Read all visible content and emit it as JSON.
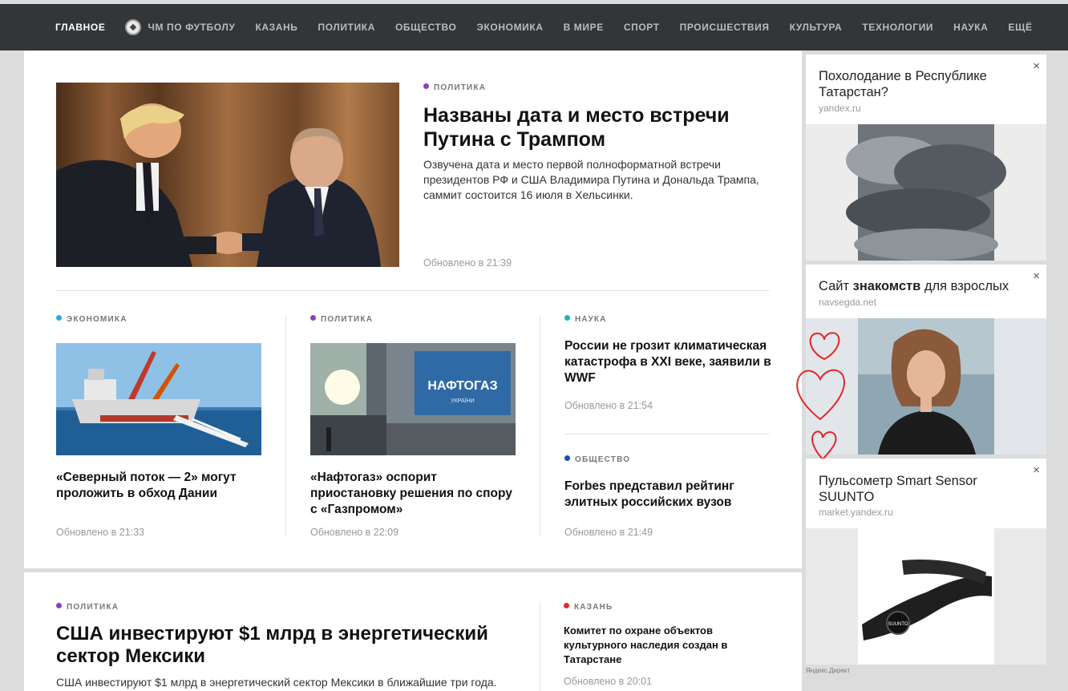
{
  "nav": {
    "items": [
      {
        "label": "ГЛАВНОЕ",
        "active": true
      },
      {
        "label": "ЧМ ПО ФУТБОЛУ",
        "icon": "soccer-ball-icon"
      },
      {
        "label": "КАЗАНЬ"
      },
      {
        "label": "ПОЛИТИКА"
      },
      {
        "label": "ОБЩЕСТВО"
      },
      {
        "label": "ЭКОНОМИКА"
      },
      {
        "label": "В МИРЕ"
      },
      {
        "label": "СПОРТ"
      },
      {
        "label": "ПРОИСШЕСТВИЯ"
      },
      {
        "label": "КУЛЬТУРА"
      },
      {
        "label": "ТЕХНОЛОГИИ"
      },
      {
        "label": "НАУКА"
      },
      {
        "label": "ЕЩЁ"
      }
    ]
  },
  "colors": {
    "politics": "#8e3fb5",
    "economy": "#29a8d8",
    "science": "#1fb5a5",
    "society": "#1a4fb0",
    "kazan": "#e8262b",
    "nav_bg": "#323639"
  },
  "lead": {
    "rubric": "ПОЛИТИКА",
    "title": "Названы дата и место встречи Путина с Трампом",
    "desc": "Озвучена дата и место первой полноформатной встречи президентов РФ и США Владимира Путина и Дональда Трампа, саммит состоится 16 июля в Хельсинки.",
    "updated": "Обновлено в 21:39"
  },
  "cards": [
    {
      "rubric": "ЭКОНОМИКА",
      "title": "«Северный поток — 2» могут проложить в обход Дании",
      "updated": "Обновлено в 21:33"
    },
    {
      "rubric": "ПОЛИТИКА",
      "title": "«Нафтогаз» оспорит приостановку решения по спору с «Газпромом»",
      "updated": "Обновлено в 22:09"
    },
    {
      "rubric": "НАУКА",
      "title": "России не грозит климатическая катастрофа в XXI веке, заявили в WWF",
      "updated": "Обновлено в 21:54"
    },
    {
      "rubric": "ОБЩЕСТВО",
      "title": "Forbes представил рейтинг элитных российских вузов",
      "updated": "Обновлено в 21:49"
    }
  ],
  "bottom": {
    "main": {
      "rubric": "ПОЛИТИКА",
      "title": "США инвестируют $1 млрд в энергетический сектор Мексики",
      "desc": "США инвестируют $1 млрд в энергетический сектор Мексики в ближайшие три года."
    },
    "side": {
      "rubric": "КАЗАНЬ",
      "title": "Комитет по охране объектов культурного наследия создан в Татарстане",
      "updated": "Обновлено в 20:01"
    }
  },
  "ads": [
    {
      "title": "Похолодание в Республике Татарстан?",
      "domain": "yandex.ru"
    },
    {
      "title_pre": "Сайт ",
      "title_bold": "знакомств",
      "title_post": " для взрослых",
      "domain": "navsegda.net"
    },
    {
      "title": "Пульсометр Smart Sensor SUUNTO",
      "domain": "market.yandex.ru"
    }
  ],
  "ad_close": "×",
  "direct_label": "Яндекс.Директ",
  "naftogaz_sign": "НАФТОГАЗ",
  "naftogaz_sub": "УКРАЇНИ",
  "suunto_brand": "SUUNTO"
}
